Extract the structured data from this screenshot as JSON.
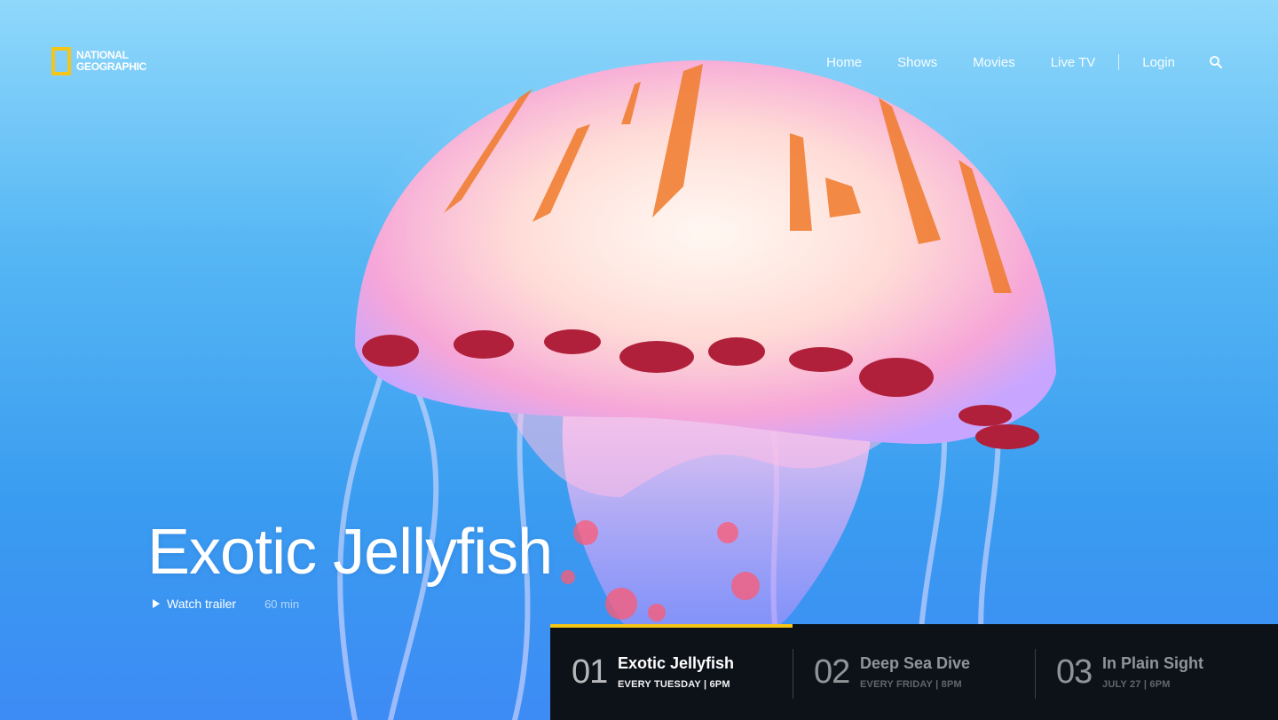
{
  "brand": {
    "logo_line1": "NATIONAL",
    "logo_line2": "GEOGRAPHIC",
    "accent": "#f5c518"
  },
  "nav": {
    "items": [
      "Home",
      "Shows",
      "Movies",
      "Live TV"
    ],
    "login": "Login",
    "search_icon": "search-icon"
  },
  "hero": {
    "title": "Exotic Jellyfish",
    "watch_trailer": "Watch trailer",
    "duration": "60 min"
  },
  "episodes": [
    {
      "number": "01",
      "title": "Exotic Jellyfish",
      "schedule": "EVERY TUESDAY | 6PM",
      "active": true
    },
    {
      "number": "02",
      "title": "Deep Sea Dive",
      "schedule": "EVERY FRIDAY | 8PM",
      "active": false
    },
    {
      "number": "03",
      "title": "In Plain Sight",
      "schedule": "JULY 27 | 6PM",
      "active": false
    }
  ]
}
